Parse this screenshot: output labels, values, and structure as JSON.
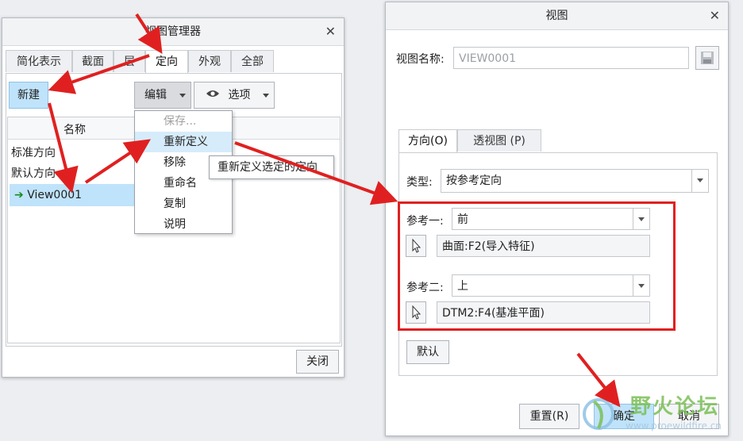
{
  "view_manager": {
    "title": "视图管理器",
    "tabs": [
      "简化表示",
      "截面",
      "层",
      "定向",
      "外观",
      "全部"
    ],
    "new_button": "新建",
    "edit_button": "编辑",
    "options_button": "选项",
    "column_header": "名称",
    "rows": [
      "标准方向",
      "默认方向",
      "View0001"
    ],
    "close_button": "关闭",
    "edit_menu": [
      "保存...",
      "重新定义",
      "移除",
      "重命名",
      "复制",
      "说明"
    ],
    "tooltip": "重新定义选定的定向"
  },
  "view_dialog": {
    "title": "视图",
    "name_label": "视图名称:",
    "name_value": "VIEW0001",
    "tabs": [
      "方向(O)",
      "透视图 (P)"
    ],
    "type_label": "类型:",
    "type_value": "按参考定向",
    "ref1_label": "参考一:",
    "ref1_value": "前",
    "ref1_entity": "曲面:F2(导入特征)",
    "ref2_label": "参考二:",
    "ref2_value": "上",
    "ref2_entity": "DTM2:F4(基准平面)",
    "default_button": "默认",
    "reset_button": "重置(R)",
    "ok_button": "确定",
    "cancel_button": "取消"
  },
  "watermark": {
    "text": "野火论坛",
    "url": "www.proewildfire.cn"
  },
  "colors": {
    "accent_blue": "#bfe3fa",
    "highlight_red": "#e02020",
    "arrow_green": "#1a8a1a"
  }
}
